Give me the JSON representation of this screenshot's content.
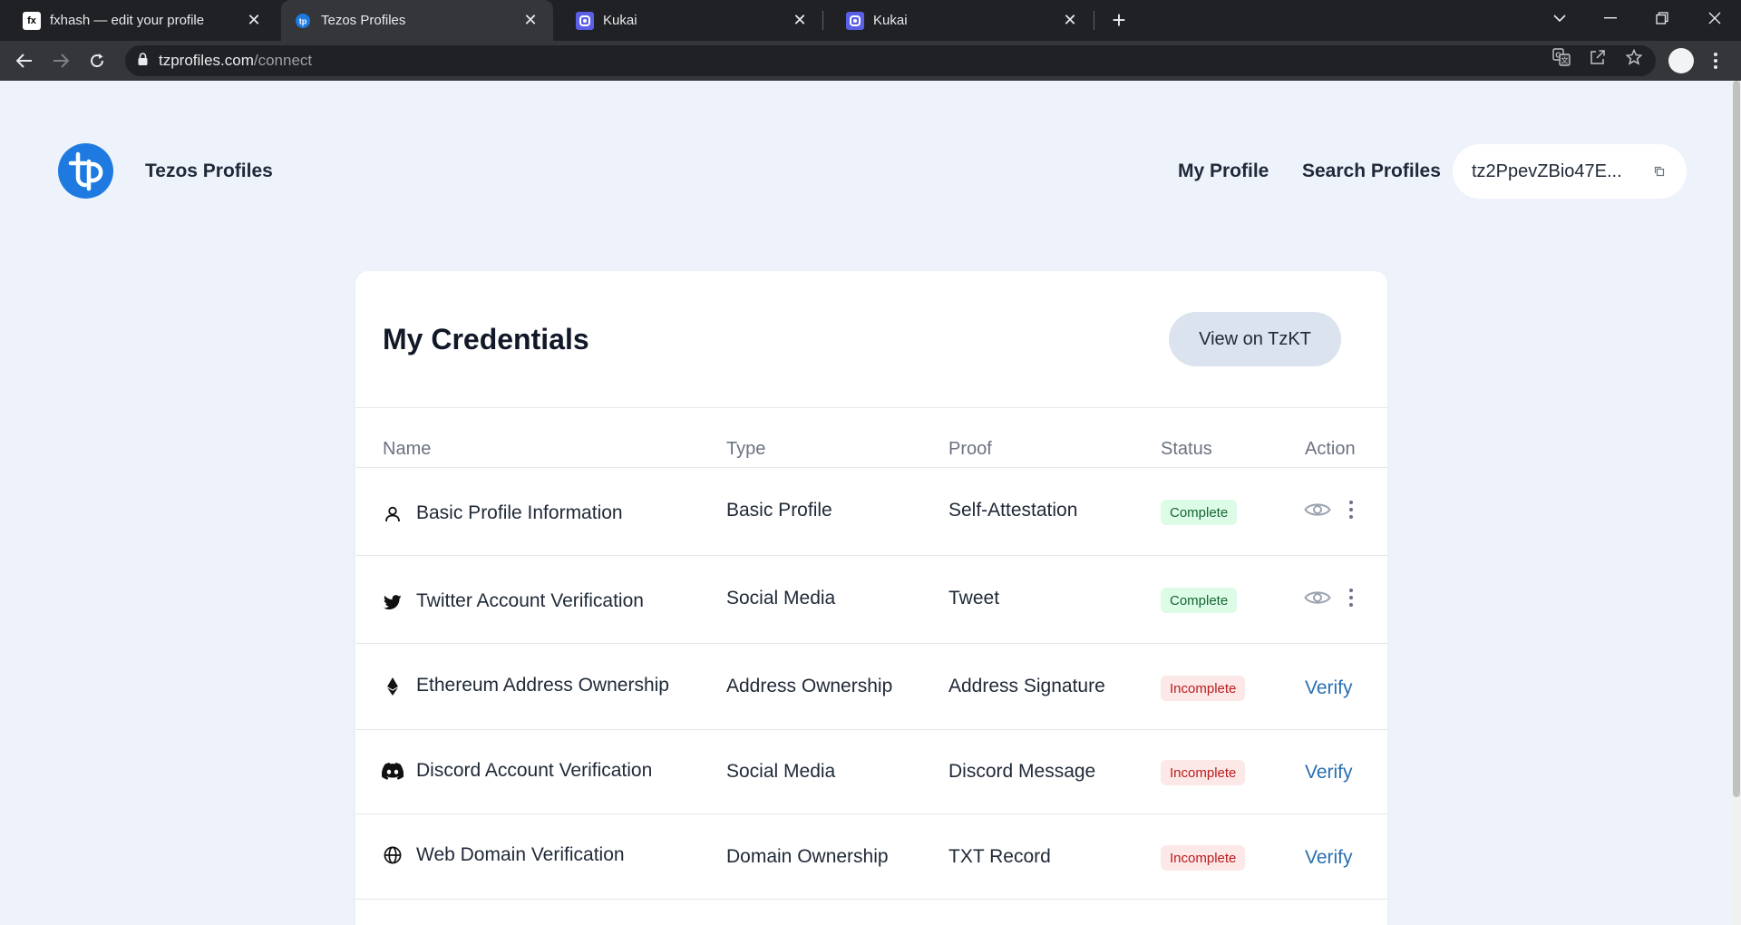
{
  "browser": {
    "tabs": [
      {
        "title": "fxhash — edit your profile",
        "favicon": "fx",
        "active": false
      },
      {
        "title": "Tezos Profiles",
        "favicon": "tp",
        "active": true
      },
      {
        "title": "Kukai",
        "favicon": "kukai",
        "active": false
      },
      {
        "title": "Kukai",
        "favicon": "kukai",
        "active": false
      }
    ],
    "url_host": "tzprofiles.com",
    "url_path": "/connect"
  },
  "header": {
    "brand": "Tezos Profiles",
    "nav": [
      "My Profile",
      "Search Profiles"
    ],
    "wallet_address": "tz2PpevZBio47E..."
  },
  "credentials": {
    "title": "My Credentials",
    "view_button": "View on TzKT",
    "columns": [
      "Name",
      "Type",
      "Proof",
      "Status",
      "Action"
    ],
    "rows": [
      {
        "icon": "person-icon",
        "name": "Basic Profile Information",
        "type": "Basic Profile",
        "proof": "Self-Attestation",
        "status": "Complete",
        "action": "view"
      },
      {
        "icon": "twitter-icon",
        "name": "Twitter Account Verification",
        "type": "Social Media",
        "proof": "Tweet",
        "status": "Complete",
        "action": "view"
      },
      {
        "icon": "ethereum-icon",
        "name": "Ethereum Address Ownership",
        "type": "Address Ownership",
        "proof": "Address Signature",
        "status": "Incomplete",
        "action": "Verify"
      },
      {
        "icon": "discord-icon",
        "name": "Discord Account Verification",
        "type": "Social Media",
        "proof": "Discord Message",
        "status": "Incomplete",
        "action": "Verify"
      },
      {
        "icon": "globe-icon",
        "name": "Web Domain Verification",
        "type": "Domain Ownership",
        "proof": "TXT Record",
        "status": "Incomplete",
        "action": "Verify"
      }
    ]
  },
  "colors": {
    "page_bg": "#edf2fb",
    "brand_blue": "#1e7ae0",
    "complete_bg": "#dcfce7",
    "incomplete_bg": "#fde8e8",
    "verify_link": "#2a6fb0"
  }
}
